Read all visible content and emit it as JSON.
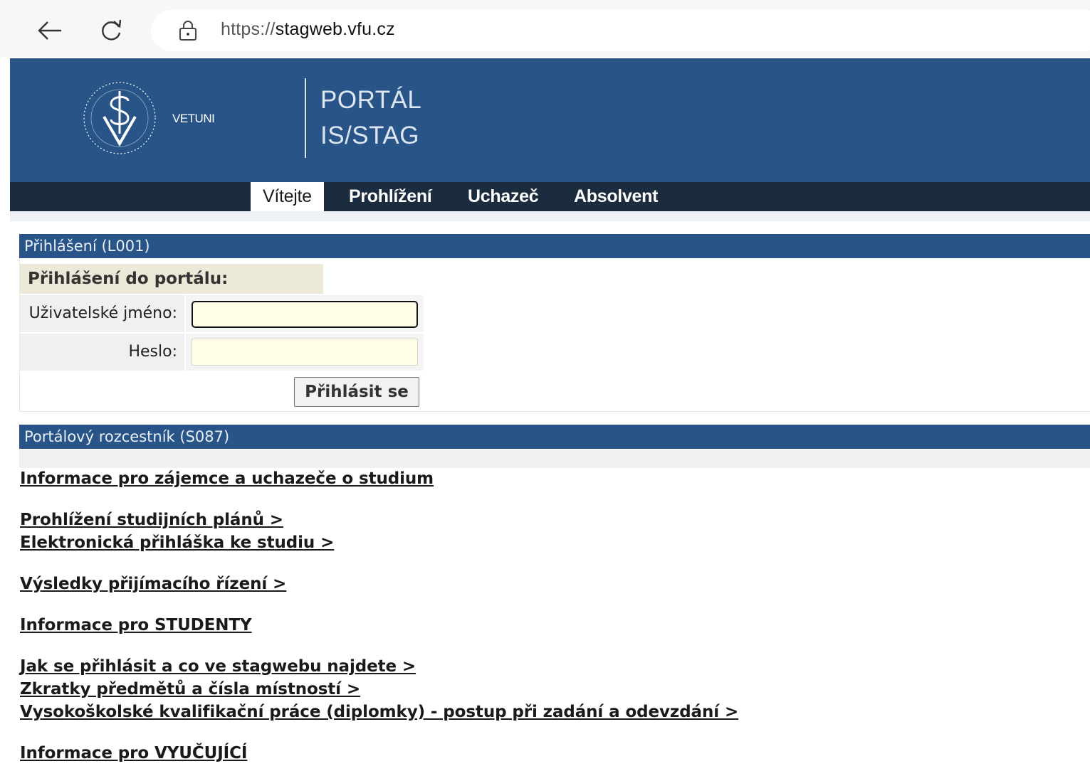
{
  "browser": {
    "url_scheme": "https://",
    "url_host": "stagweb.vfu.cz"
  },
  "header": {
    "brand": "VETUNI",
    "title_line1": "PORTÁL",
    "title_line2": "IS/STAG",
    "color": "#285487"
  },
  "menu": {
    "tabs": [
      {
        "label": "Vítejte",
        "active": true
      },
      {
        "label": "Prohlížení",
        "active": false
      },
      {
        "label": "Uchazeč",
        "active": false
      },
      {
        "label": "Absolvent",
        "active": false
      }
    ]
  },
  "login": {
    "panel_title": "Přihlášení (L001)",
    "box_title": "Přihlášení do portálu:",
    "username_label": "Uživatelské jméno:",
    "username_value": "",
    "password_label": "Heslo:",
    "password_value": "",
    "submit_label": "Přihlásit se"
  },
  "signpost": {
    "panel_title": "Portálový rozcestník (S087)",
    "links": [
      "Informace pro zájemce a uchazeče o studium",
      "Prohlížení studijních plánů >",
      "Elektronická přihláška ke studiu >",
      "Výsledky přijímacího řízení >",
      "Informace pro STUDENTY",
      "Jak se přihlásit a co ve stagwebu najdete >",
      "Zkratky předmětů a čísla místností >",
      "Vysokoškolské kvalifikační práce (diplomky) - postup při zadání a odevzdání >",
      "Informace pro VYUČUJÍCÍ"
    ]
  }
}
